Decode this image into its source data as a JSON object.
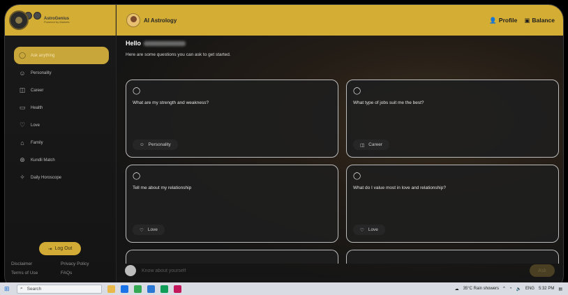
{
  "sidebar": {
    "brand_name": "AstroGenius",
    "brand_sub": "Powered by Markets",
    "items": [
      {
        "label": "Ask anything",
        "icon": "chat-bubble-icon"
      },
      {
        "label": "Personality",
        "icon": "smiley-icon"
      },
      {
        "label": "Career",
        "icon": "briefcase-icon"
      },
      {
        "label": "Health",
        "icon": "health-monitor-icon"
      },
      {
        "label": "Love",
        "icon": "heart-icon"
      },
      {
        "label": "Family",
        "icon": "home-icon"
      },
      {
        "label": "Kundli Match",
        "icon": "kundli-icon"
      },
      {
        "label": "Daily Horoscope",
        "icon": "horoscope-icon"
      }
    ],
    "logout_label": "Log Out",
    "footer": {
      "disclaimer": "Disclaimer",
      "privacy": "Privacy Policy",
      "terms": "Terms of Use",
      "faqs": "FAQs"
    }
  },
  "header": {
    "title": "AI Astrology",
    "profile": "Profile",
    "balance": "Balance"
  },
  "main": {
    "greeting": "Hello",
    "intro": "Here are some questions you can ask to get started.",
    "cards": [
      {
        "question": "What are my strength and weakness?",
        "tag": "Personality",
        "tag_icon": "smiley-icon"
      },
      {
        "question": "What type of jobs suit me the best?",
        "tag": "Career",
        "tag_icon": "briefcase-icon"
      },
      {
        "question": "Tell me about my relationship",
        "tag": "Love",
        "tag_icon": "heart-icon"
      },
      {
        "question": "What do I value most in love and relationship?",
        "tag": "Love",
        "tag_icon": "heart-icon"
      }
    ],
    "input_placeholder": "Know about yourself",
    "ask_button": "Ask"
  },
  "taskbar": {
    "search": "Search",
    "weather": "35°C  Rain showers",
    "lang": "ENG",
    "time": "5:32 PM"
  },
  "colors": {
    "accent": "#d4ad34",
    "background": "#161616"
  }
}
